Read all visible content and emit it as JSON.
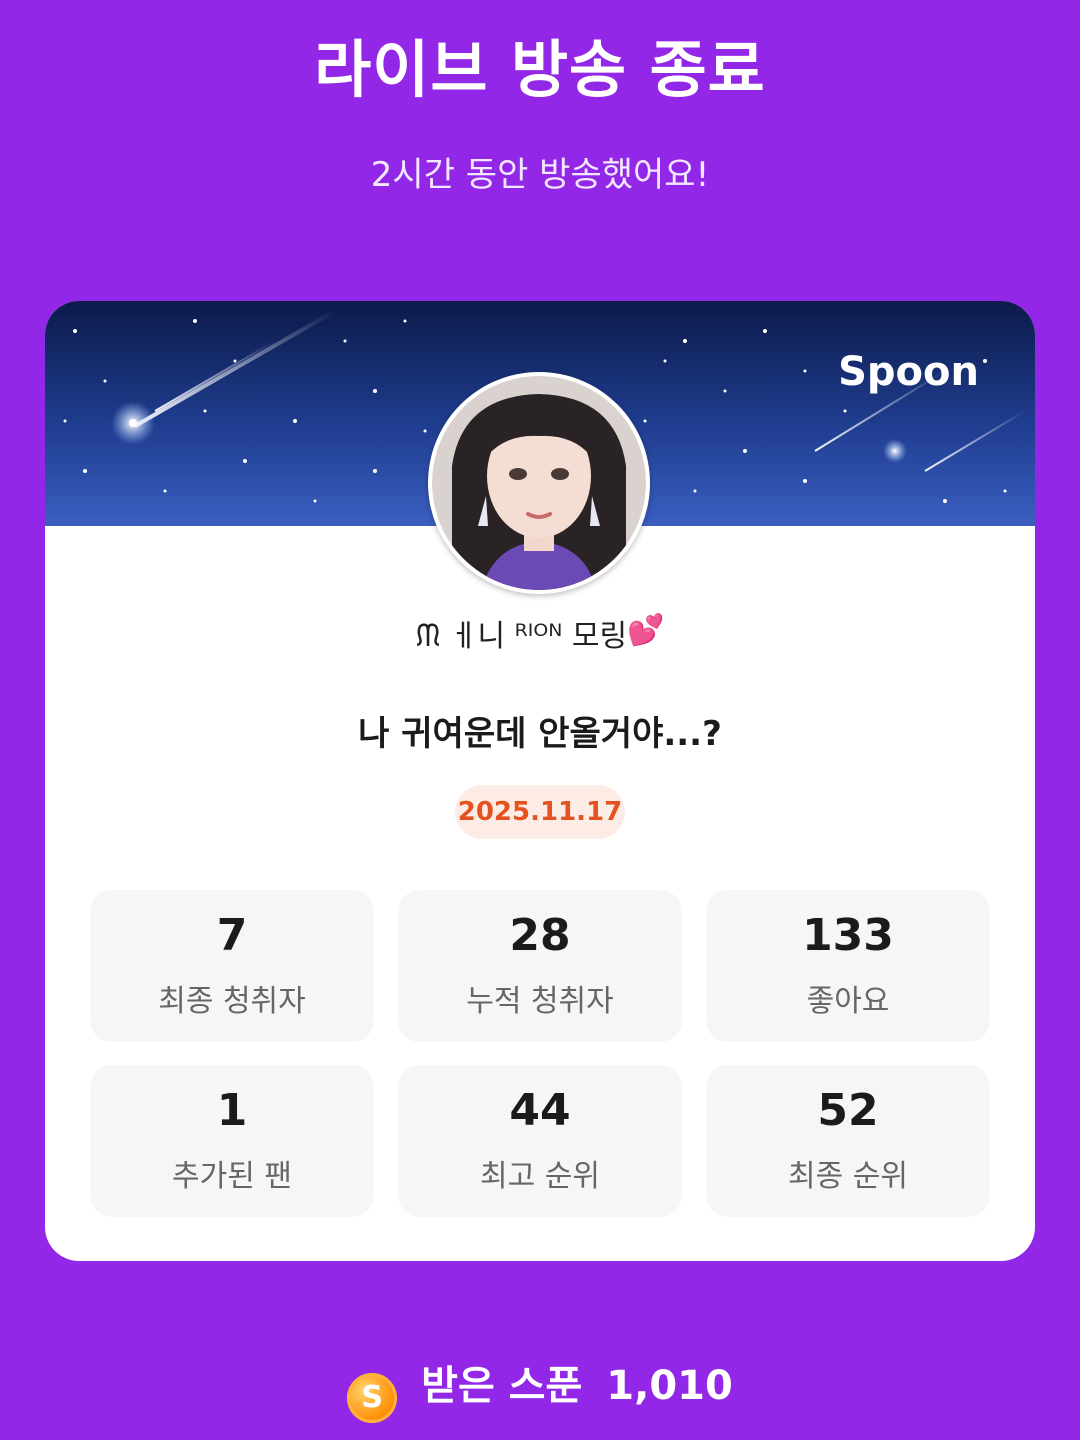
{
  "header": {
    "title": "라이브 방송 종료",
    "subtitle": "2시간 동안 방송했어요!"
  },
  "card": {
    "brand": "Spoon",
    "host_name": "ᙏ ㅔ니 ᴿᴵᴼᴺ 모링",
    "host_emoji_icon": "two-hearts-icon",
    "host_emoji": "💕",
    "live_title": "나 귀여운데 안올거야...?",
    "date": "2025.11.17",
    "stats": [
      {
        "value": "7",
        "label": "최종 청취자"
      },
      {
        "value": "28",
        "label": "누적 청취자"
      },
      {
        "value": "133",
        "label": "좋아요"
      },
      {
        "value": "1",
        "label": "추가된 팬"
      },
      {
        "value": "44",
        "label": "최고 순위"
      },
      {
        "value": "52",
        "label": "최종 순위"
      }
    ]
  },
  "footer": {
    "coin_icon": "spoon-coin-icon",
    "coin_letter": "S",
    "label": "받은 스푼",
    "value": "1,010"
  },
  "colors": {
    "background": "#9227e8",
    "date_text": "#e4531f",
    "date_badge_bg": "#fdece6",
    "stat_box_bg": "#f6f6f6"
  }
}
